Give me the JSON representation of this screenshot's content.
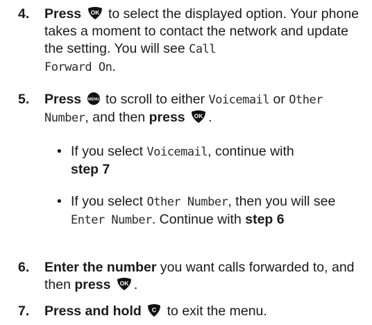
{
  "steps": [
    {
      "number": "4.",
      "bold_lead": "Press",
      "after_icon": "to select the displayed option. Your phone takes a moment to contact the network and update the setting. You will see",
      "lcd_text_1": "Call",
      "lcd_text_2": "Forward On",
      "tail": ".",
      "icon": "ok-button-icon"
    },
    {
      "number": "5.",
      "bold_lead": "Press",
      "after_icon": "to scroll to either",
      "lcd_a": "Voicemail",
      "or_word": "or",
      "lcd_b1": "Other",
      "lcd_b2": "Number",
      "mid": ", and then",
      "bold_press": "press",
      "tail": ".",
      "icon_1": "menu-button-icon",
      "icon_2": "ok-button-icon",
      "bullets": [
        {
          "prefix": "If you select",
          "lcd": "Voicemail",
          "suffix": ", continue with",
          "bold": "step 7"
        },
        {
          "prefix": "If you select",
          "lcd": "Other Number",
          "suffix": ", then you will see",
          "lcd2": "Enter Number",
          "suffix2": ". Continue with",
          "bold": "step 6"
        }
      ]
    },
    {
      "number": "6.",
      "bold_lead": "Enter the number",
      "text": "you want calls forwarded to, and then",
      "bold_press": "press",
      "tail": ".",
      "icon": "ok-button-icon"
    },
    {
      "number": "7.",
      "bold_lead": "Press and hold",
      "text": "to exit the menu.",
      "icon": "clear-button-icon"
    }
  ],
  "colors": {
    "text": "#1a1a1a",
    "key_fill": "#111111",
    "key_label": "#ffffff"
  }
}
